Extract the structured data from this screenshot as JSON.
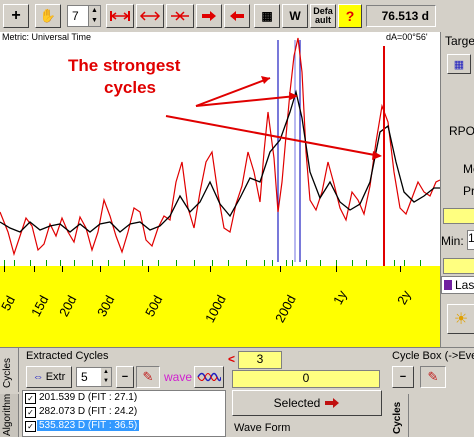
{
  "toolbar": {
    "plus_icon": "plus-icon",
    "hand_icon": "hand-icon",
    "zoom_icon": "zoom-icon",
    "zoom_value": "7",
    "w_label": "W",
    "default_label_top": "Defa",
    "default_label_bottom": "ault",
    "help_label": "?",
    "readout": "76.513 d"
  },
  "chart": {
    "metric_label": "Metric: Universal Time",
    "da_label": "dA=00°56'",
    "annotation_line1": "The strongest",
    "annotation_line2": "cycles",
    "colors": {
      "raw": "#e00000",
      "fitted": "#000000",
      "marker": "#e00000",
      "cycle": "#2020c0",
      "ticks": "#00a000"
    },
    "axis_labels": [
      "5d",
      "15d",
      "20d",
      "30d",
      "50d",
      "100d",
      "200d",
      "1y",
      "2y"
    ]
  },
  "right_panel": {
    "target_label": "Targe",
    "rpo_label": "RPO",
    "me_label": "Me",
    "pr_label": "Pr",
    "min_label": "Min:",
    "min_value": "1",
    "las_label": "Las"
  },
  "bottom": {
    "cycles_tab": "Cycles",
    "algorithm_tab": "Algorithm",
    "extracted_title": "Extracted Cycles",
    "extr_label": "Extr",
    "extr_count": "5",
    "minus_label": "−",
    "wave_label": "wave",
    "cycles_list": [
      {
        "text": "201.539 D  (FIT : 27.1)",
        "checked": true,
        "selected": false
      },
      {
        "text": "282.073 D  (FIT : 24.2)",
        "checked": true,
        "selected": false
      },
      {
        "text": "535.823 D  (FIT : 36.5)",
        "checked": true,
        "selected": true
      }
    ],
    "arrow_left": "<",
    "count_value": "3",
    "index_value": "0",
    "selected_label": "Selected",
    "wave_form_label": "Wave Form",
    "cycle_box_label": "Cycle Box (->Even",
    "cycles_vert_label": "Cycles",
    "cycle_box_minus": "−"
  }
}
